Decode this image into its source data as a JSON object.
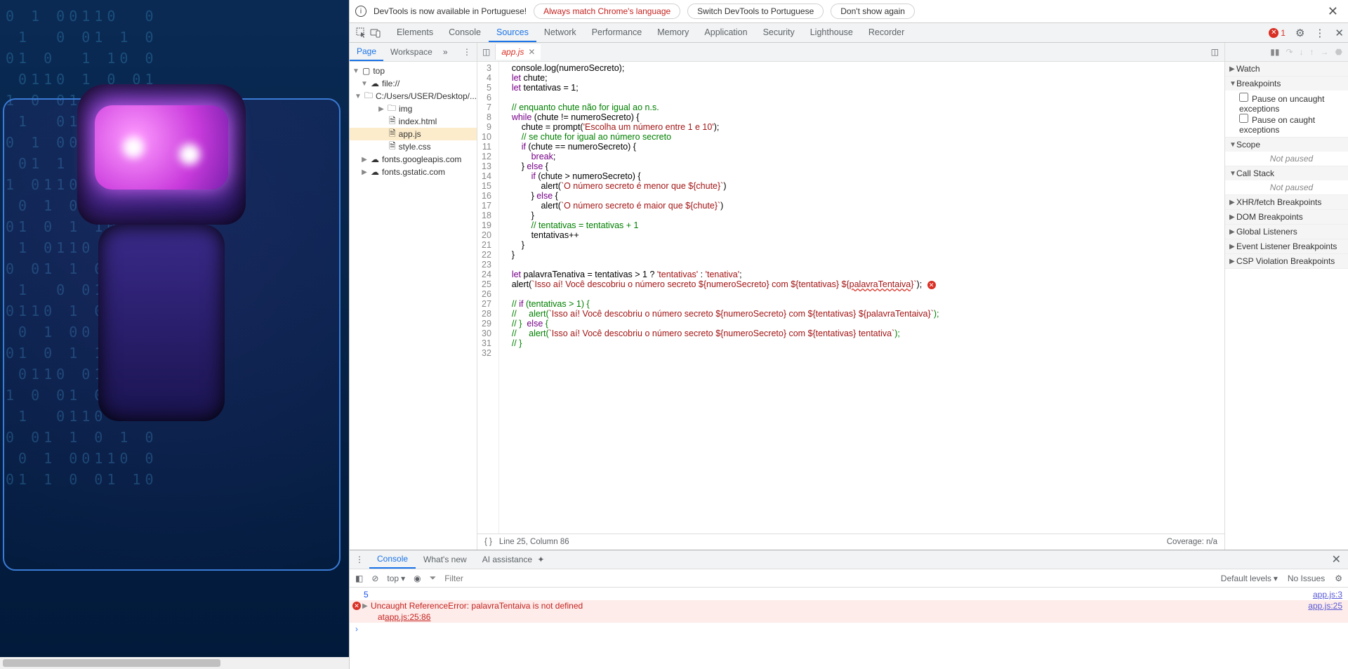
{
  "infobar": {
    "message": "DevTools is now available in Portuguese!",
    "btn_match": "Always match Chrome's language",
    "btn_switch": "Switch DevTools to Portuguese",
    "btn_dont": "Don't show again"
  },
  "main_tabs": [
    "Elements",
    "Console",
    "Sources",
    "Network",
    "Performance",
    "Memory",
    "Application",
    "Security",
    "Lighthouse",
    "Recorder"
  ],
  "main_tabs_active": 2,
  "error_count": "1",
  "nav_tabs": {
    "page": "Page",
    "workspace": "Workspace"
  },
  "tree": {
    "top": "top",
    "file": "file://",
    "path": "C:/Users/USER/Desktop/...",
    "img": "img",
    "index": "index.html",
    "app": "app.js",
    "style": "style.css",
    "gapis": "fonts.googleapis.com",
    "gstatic": "fonts.gstatic.com"
  },
  "open_file": "app.js",
  "code": {
    "3": "    console.log(numeroSecreto);",
    "4": "    let chute;",
    "5": "    let tentativas = 1;",
    "6": "",
    "7": "    // enquanto chute não for igual ao n.s.",
    "8": "    while (chute != numeroSecreto) {",
    "9": "        chute = prompt('Escolha um número entre 1 e 10');",
    "10": "        // se chute for igual ao número secreto",
    "11": "        if (chute == numeroSecreto) {",
    "12": "            break;",
    "13": "        } else {",
    "14": "            if (chute > numeroSecreto) {",
    "15": "                alert(`O número secreto é menor que ${chute}`)",
    "16": "            } else {",
    "17": "                alert(`O número secreto é maior que ${chute}`)",
    "18": "            }",
    "19": "            // tentativas = tentativas + 1",
    "20": "            tentativas++",
    "21": "        }",
    "22": "    }",
    "23": "",
    "24": "    let palavraTenativa = tentativas > 1 ? 'tentativas' : 'tenativa';",
    "25": "    alert(`Isso aí! Você descobriu o número secreto ${numeroSecreto} com ${tentativas} ${palavraTentaiva}`);",
    "26": "",
    "27": "    // if (tentativas > 1) {",
    "28": "    //     alert(`Isso aí! Você descobriu o número secreto ${numeroSecreto} com ${tentativas} ${palavraTentaiva}`);",
    "29": "    // }  else {",
    "30": "    //     alert(`Isso aí! Você descobriu o número secreto ${numeroSecreto} com ${tentativas} tentativa`);",
    "31": "    // }",
    "32": ""
  },
  "status": {
    "pos": "Line 25, Column 86",
    "coverage": "Coverage: n/a"
  },
  "dbg": {
    "watch": "Watch",
    "breakpoints": "Breakpoints",
    "pause_uncaught": "Pause on uncaught exceptions",
    "pause_caught": "Pause on caught exceptions",
    "scope": "Scope",
    "not_paused": "Not paused",
    "callstack": "Call Stack",
    "xhr": "XHR/fetch Breakpoints",
    "dom": "DOM Breakpoints",
    "global": "Global Listeners",
    "event": "Event Listener Breakpoints",
    "csp": "CSP Violation Breakpoints"
  },
  "drawer_tabs": {
    "console": "Console",
    "whatsnew": "What's new",
    "ai": "AI assistance"
  },
  "console_toolbar": {
    "ctx": "top",
    "filter_placeholder": "Filter",
    "levels": "Default levels",
    "issues": "No Issues"
  },
  "console": {
    "l1_val": "5",
    "l1_src": "app.js:3",
    "l2_msg": "Uncaught ReferenceError: palavraTentaiva is not defined",
    "l2_src": "app.js:25",
    "l3_pre": "    at ",
    "l3_link": "app.js:25:86"
  }
}
